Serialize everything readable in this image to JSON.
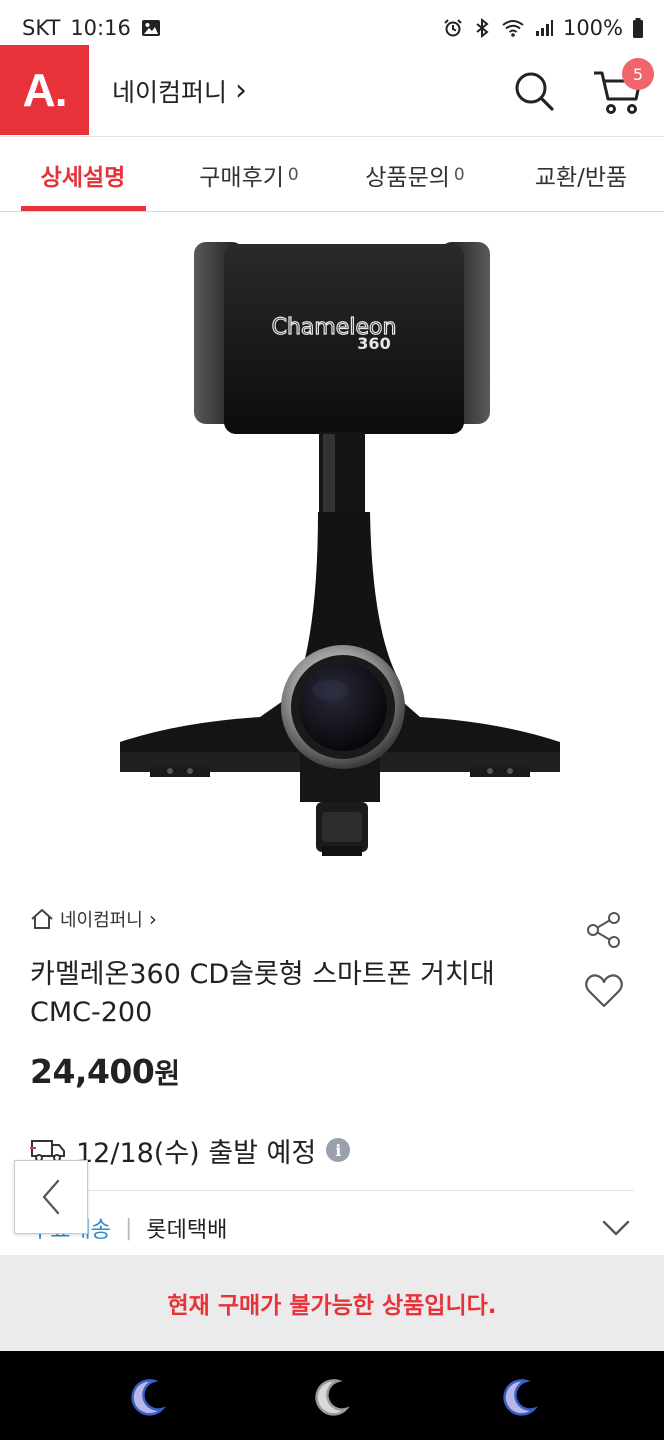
{
  "status_bar": {
    "carrier": "SKT",
    "time": "10:16",
    "battery": "100%",
    "icons": [
      "gallery-icon",
      "alarm-icon",
      "bluetooth-icon",
      "wifi-icon",
      "signal-icon",
      "battery-icon"
    ]
  },
  "header": {
    "logo_text": "A.",
    "store_name": "네이컴퍼니",
    "store_chevron": "›",
    "cart_badge": "5",
    "accent_color": "#e8323a"
  },
  "tabs": [
    {
      "label": "상세설명",
      "count": "",
      "active": true
    },
    {
      "label": "구매후기",
      "count": "0",
      "active": false
    },
    {
      "label": "상품문의",
      "count": "0",
      "active": false
    },
    {
      "label": "교환/반품",
      "count": "",
      "active": false
    }
  ],
  "product": {
    "image_brand_text": "Chameleon",
    "image_model_text": "360",
    "seller": "네이컴퍼니",
    "seller_chevron": "›",
    "title": "카멜레온360 CD슬롯형 스마트폰 거치대 CMC-200",
    "price": "24,400",
    "currency": "원"
  },
  "shipping": {
    "dispatch": "12/18(수) 출발 예정",
    "info_glyph": "i",
    "fee_label": "무료배송",
    "separator": "|",
    "courier": "롯데택배"
  },
  "notice": {
    "unavailable": "현재 구매가 불가능한 상품입니다."
  },
  "nav_bar": {
    "buttons": [
      "recent-apps",
      "home",
      "back"
    ]
  }
}
